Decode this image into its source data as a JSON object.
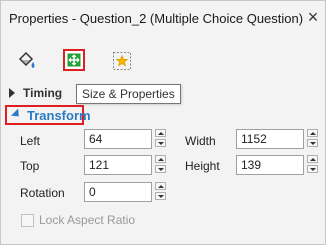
{
  "window": {
    "title": "Properties - Question_2 (Multiple Choice Question)",
    "close_icon": "close-icon"
  },
  "toolbar": {
    "fill_icon": "paint-bucket-icon",
    "size_icon": "size-properties-icon",
    "effects_icon": "star-effects-icon",
    "tooltip": "Size & Properties"
  },
  "sections": {
    "timing": "Timing",
    "transform": "Transform"
  },
  "transform": {
    "left_label": "Left",
    "left_value": "64",
    "top_label": "Top",
    "top_value": "121",
    "rotation_label": "Rotation",
    "rotation_value": "0",
    "width_label": "Width",
    "width_value": "1152",
    "height_label": "Height",
    "height_value": "139",
    "lock_label": "Lock Aspect Ratio",
    "lock_checked": false
  },
  "colors": {
    "accent": "#2b7bc4",
    "highlight": "#e02020",
    "green": "#22a03a"
  }
}
